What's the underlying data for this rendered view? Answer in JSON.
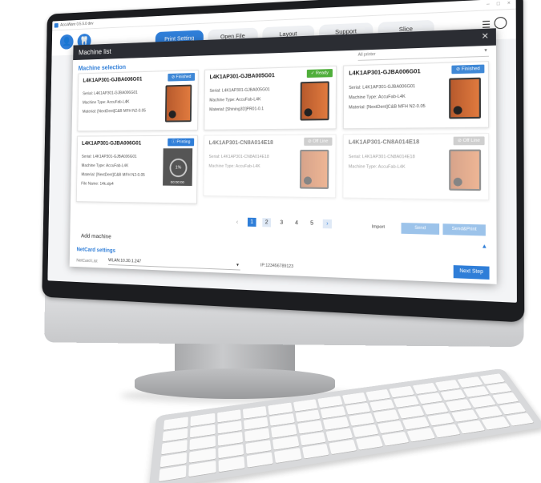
{
  "window": {
    "title": "AccuWare 0.5.5.0 dev"
  },
  "nav": {
    "tabs": [
      {
        "label": "Print Setting",
        "active": true
      },
      {
        "label": "Open File"
      },
      {
        "label": "Layout"
      },
      {
        "label": "Support"
      },
      {
        "label": "Slice"
      }
    ]
  },
  "dialog": {
    "title": "Machine list",
    "section_title": "Machine selection",
    "filter_value": "All printer",
    "cards": [
      {
        "name": "L4K1AP301-GJBA006G01",
        "status": "Finished",
        "serial": "Serial: L4K1AP301-GJBA006G01",
        "type": "Machine Type: AccuFab-L4K",
        "material": "Material: [NextDent]C&B MFH N2-0.05"
      },
      {
        "name": "L4K1AP301-GJBA005G01",
        "status": "Ready",
        "serial": "Serial: L4K1AP301-GJBA005G01",
        "type": "Machine Type: AccuFab-L4K",
        "material": "Material: [Shining3D]PR01-0.1"
      },
      {
        "name": "L4K1AP301-GJBA006G01",
        "status": "Finished",
        "serial": "Serial: L4K1AP301-GJBA006G01",
        "type": "Machine Type: AccuFab-L4K",
        "material": "Material: [NextDent]C&B MFH N2-0.05"
      },
      {
        "name": "L4K1AP301-GJBA006G01",
        "status": "Printing",
        "serial": "Serial: L4K1AP301-GJBA006G01",
        "type": "Machine Type: AccuFab-L4K",
        "material": "Material: [NextDent]C&B MFH N2-0.05",
        "file": "File Name: 14k.slp4",
        "progress": "1%",
        "time": "00:00:00"
      },
      {
        "name": "L4K1AP301-CN8A014E18",
        "status": "Off Line",
        "serial": "Serial: L4K1AP301-CN8A014E18",
        "type": "Machine Type: AccuFab-L4K"
      },
      {
        "name": "L4K1AP301-CN8A014E18",
        "status": "Off Line",
        "serial": "Serial: L4K1AP301-CN8A014E18",
        "type": "Machine Type: AccuFab-L4K"
      }
    ],
    "pagination": {
      "pages": [
        "1",
        "2",
        "3",
        "4",
        "5"
      ],
      "current": "1"
    },
    "buttons": {
      "import": "Import",
      "send": "Send",
      "send_print": "Send&Print"
    },
    "add_machine": "Add machine",
    "netcard": {
      "title": "NetCard settings",
      "label": "NetCard List",
      "value": "WLAN:10.30.1.247",
      "ip": "IP:123456789123"
    },
    "next_step": "Next Step"
  },
  "colors": {
    "accent": "#2f7ed8",
    "ready": "#4fae3a",
    "dialog_header": "#2b2d33"
  }
}
